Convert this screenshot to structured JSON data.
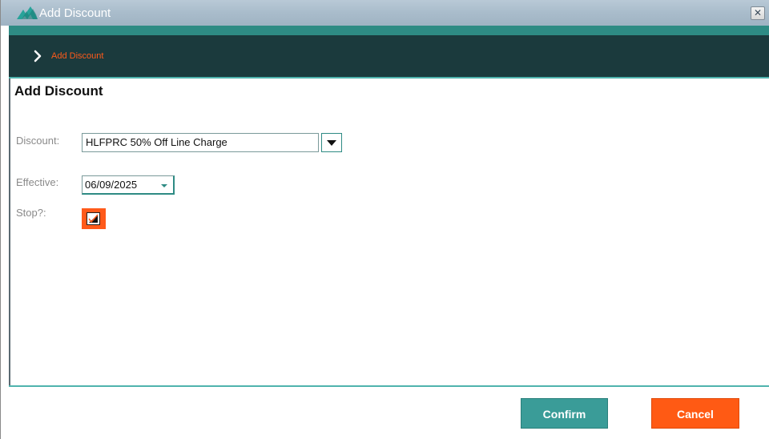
{
  "window": {
    "title": "Add Discount",
    "close_label": "✕"
  },
  "breadcrumb": {
    "items": [
      {
        "label": "Add Discount"
      }
    ]
  },
  "page": {
    "title": "Add Discount"
  },
  "form": {
    "discount": {
      "label": "Discount:",
      "value": "HLFPRC  50% Off Line Charge"
    },
    "effective": {
      "label": "Effective:",
      "value": "06/09/2025"
    },
    "stop": {
      "label": "Stop?:",
      "checked": true
    }
  },
  "actions": {
    "confirm_label": "Confirm",
    "cancel_label": "Cancel"
  },
  "colors": {
    "accent_teal": "#2e8b84",
    "header_dark": "#1b3a3d",
    "accent_orange": "#ff5a1a"
  }
}
